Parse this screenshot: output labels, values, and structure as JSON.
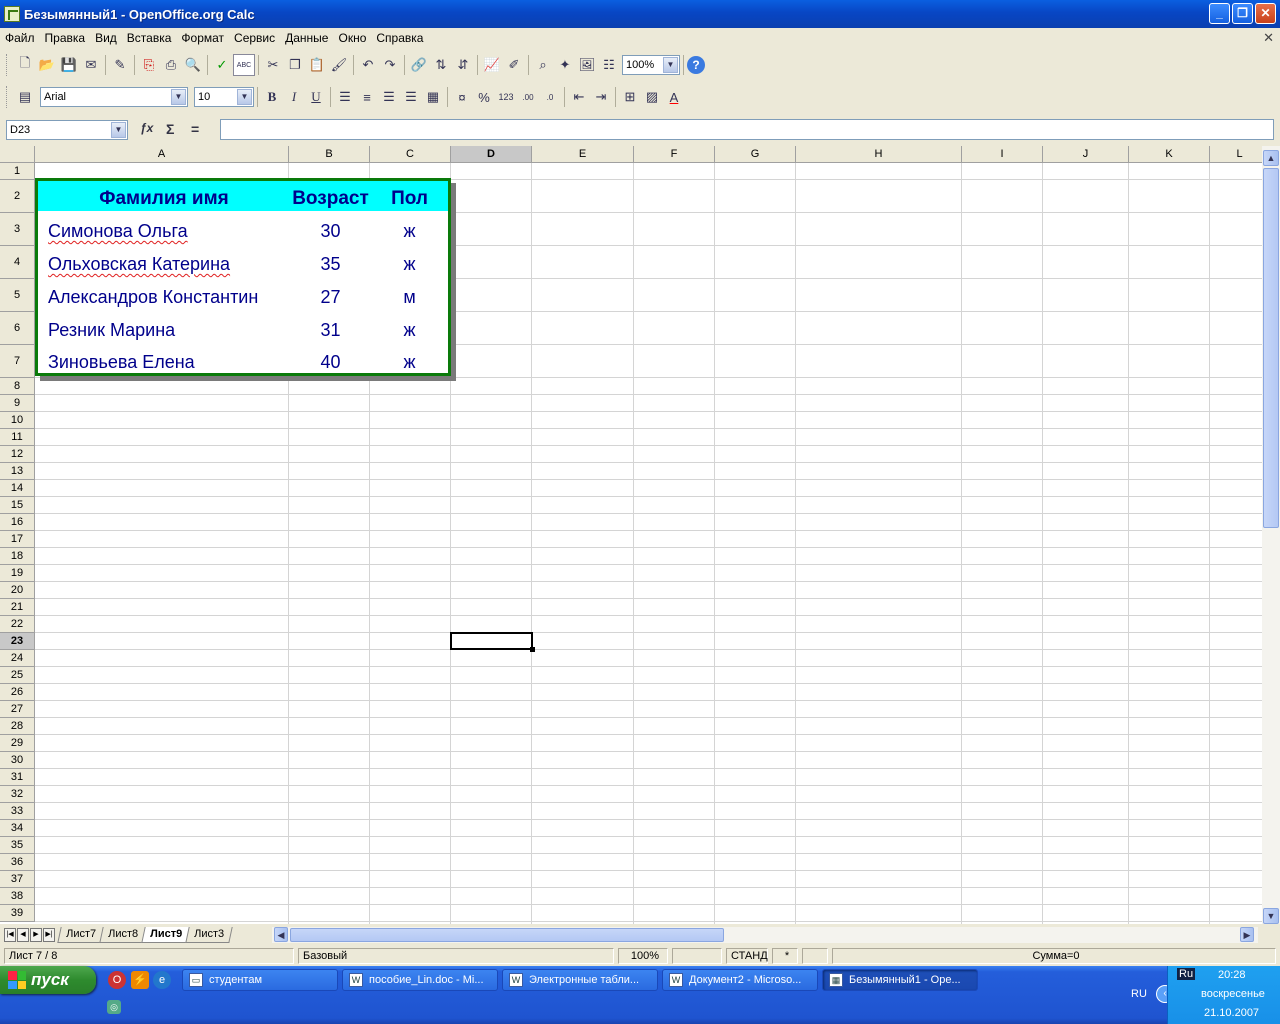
{
  "window": {
    "title": "Безымянный1 - OpenOffice.org Calc",
    "btn_min": "_",
    "btn_max": "❐",
    "btn_close": "✕"
  },
  "menu": [
    "Файл",
    "Правка",
    "Вид",
    "Вставка",
    "Формат",
    "Сервис",
    "Данные",
    "Окно",
    "Справка"
  ],
  "menu_close": "✕",
  "toolbar": {
    "zoom": "100%",
    "font_name": "Arial",
    "font_size": "10",
    "bold": "B",
    "italic": "I",
    "underline": "U"
  },
  "formula": {
    "name_box": "D23",
    "value": ""
  },
  "columns": [
    "A",
    "B",
    "C",
    "D",
    "E",
    "F",
    "G",
    "H",
    "I",
    "J",
    "K",
    "L"
  ],
  "selected_column": "D",
  "rows": [
    "1",
    "2",
    "3",
    "4",
    "5",
    "6",
    "7",
    "8",
    "9",
    "10",
    "11",
    "12",
    "13",
    "14",
    "15",
    "16",
    "17",
    "18",
    "19",
    "20",
    "21",
    "22",
    "23",
    "24",
    "25",
    "26",
    "27",
    "28",
    "29",
    "30",
    "31",
    "32",
    "33",
    "34",
    "35",
    "36",
    "37",
    "38",
    "39"
  ],
  "selected_row": "23",
  "table": {
    "headers": [
      "Фамилия имя",
      "Возраст",
      "Пол"
    ],
    "rows": [
      {
        "name": "Симонова Ольга",
        "age": "30",
        "sex": "ж"
      },
      {
        "name": "Ольховская Катерина",
        "age": "35",
        "sex": "ж"
      },
      {
        "name": "Александров Константин",
        "age": "27",
        "sex": "м"
      },
      {
        "name": "Резник Марина",
        "age": "31",
        "sex": "ж"
      },
      {
        "name": "Зиновьева Елена",
        "age": "40",
        "sex": "ж"
      }
    ],
    "header_bg": "#00ffff",
    "text_color": "#00008b",
    "border_color": "#0a7a0a"
  },
  "sheet_tabs": [
    "Лист7",
    "Лист8",
    "Лист9",
    "Лист3"
  ],
  "active_tab": "Лист9",
  "status": {
    "sheet": "Лист 7 / 8",
    "style": "Базовый",
    "zoom": "100%",
    "mode": "СТАНД",
    "modified": "*",
    "sum": "Сумма=0"
  },
  "taskbar": {
    "start": "пуск",
    "tasks": [
      {
        "label": "студентам",
        "icon": "folder-icon"
      },
      {
        "label": "пособие_Lin.doc - Mi...",
        "icon": "word-icon"
      },
      {
        "label": "Электронные табли...",
        "icon": "word-icon"
      },
      {
        "label": "Документ2 - Microso...",
        "icon": "word-icon"
      },
      {
        "label": "Безымянный1 - Ope...",
        "icon": "calc-icon"
      }
    ],
    "lang": "RU",
    "lang_badge": "Ru",
    "time": "20:28",
    "day": "воскресенье",
    "date": "21.10.2007"
  }
}
